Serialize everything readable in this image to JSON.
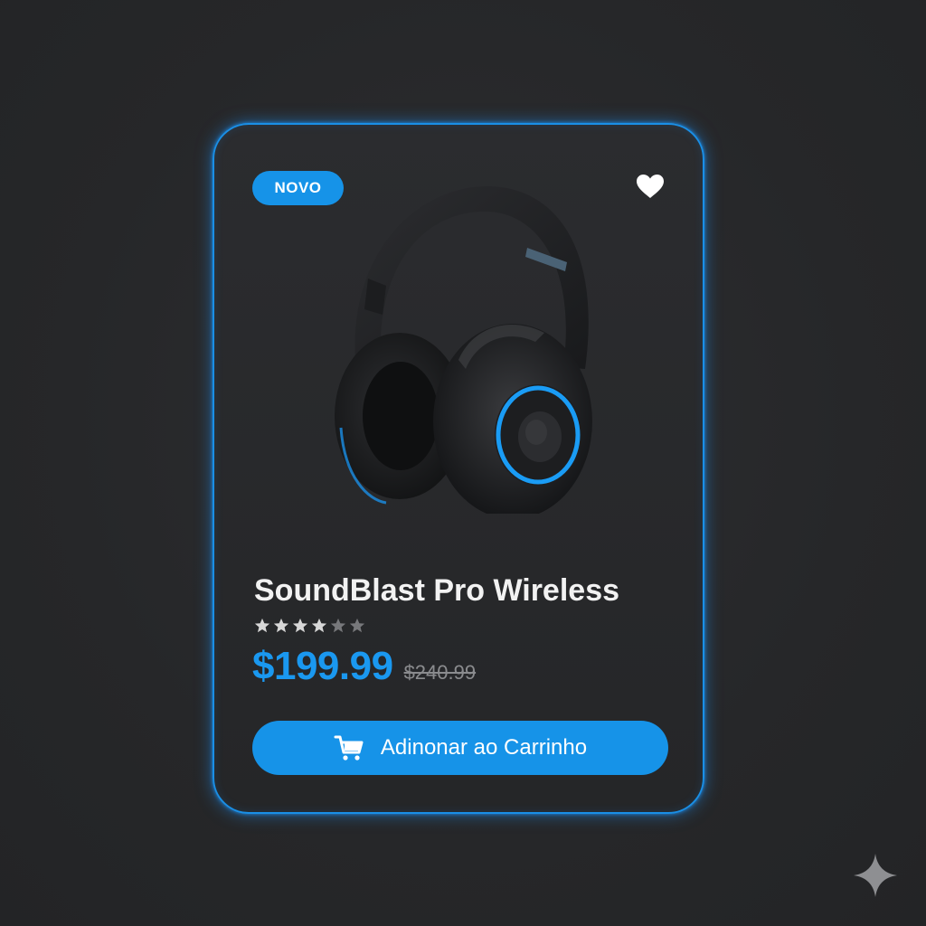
{
  "product_card": {
    "badge": "NOVO",
    "title": "SoundBlast Pro Wireless",
    "rating": {
      "filled": 4,
      "total": 6
    },
    "price": "$199.99",
    "old_price": "$240.99",
    "cta_label": "Adinonar ao Carrinho"
  },
  "icons": {
    "favorite": "heart-icon",
    "cart": "cart-icon",
    "watermark": "sparkle-icon"
  },
  "colors": {
    "accent": "#1693e8",
    "price": "#1a98f0",
    "background": "#262729",
    "card": "#2a2b2e"
  }
}
